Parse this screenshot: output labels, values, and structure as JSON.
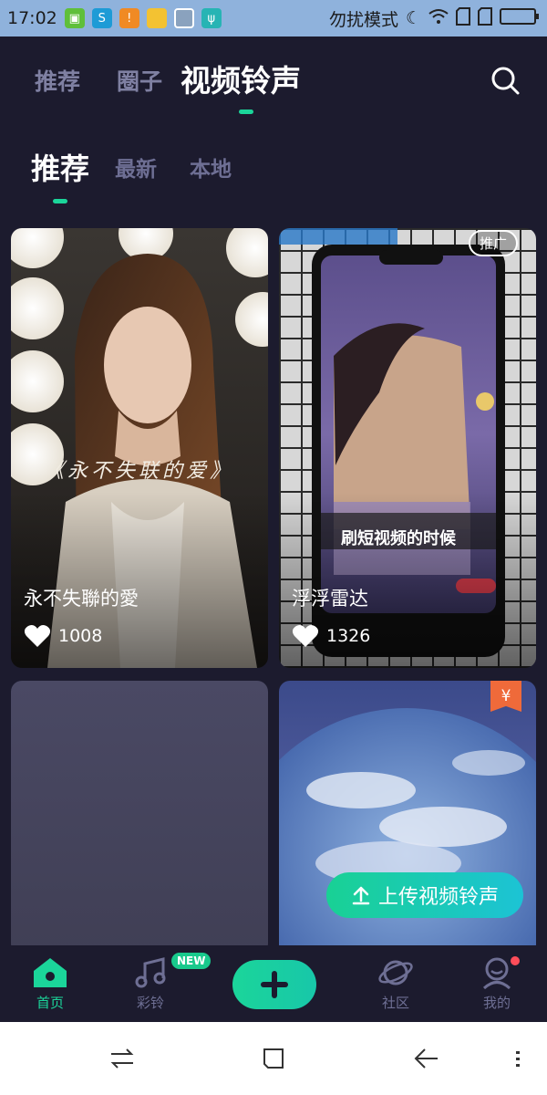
{
  "status_bar": {
    "time": "17:02",
    "dnd_text": "勿扰模式",
    "icons": [
      "app-icon",
      "sync-icon",
      "warning-icon",
      "folder-icon",
      "brush-icon",
      "usb-icon",
      "moon-icon",
      "wifi-icon",
      "sim1-icon",
      "sim2-icon",
      "battery-icon"
    ]
  },
  "top_tabs": {
    "items": [
      {
        "label": "推荐"
      },
      {
        "label": "圈子"
      },
      {
        "label": "视频铃声"
      }
    ],
    "active_index": 2
  },
  "sub_tabs": {
    "items": [
      {
        "label": "推荐"
      },
      {
        "label": "最新"
      },
      {
        "label": "本地"
      }
    ],
    "active_index": 0
  },
  "cards": [
    {
      "title": "永不失聯的愛",
      "likes": "1008",
      "overlay_text": "《永不失联的爱》"
    },
    {
      "title": "浮浮雷达",
      "likes": "1326",
      "promo_badge": "推广",
      "overlay_text": "刷短视频的时候"
    },
    {},
    {
      "yen_tag": "¥"
    }
  ],
  "upload_button": {
    "label": "上传视频铃声"
  },
  "bottom_nav": {
    "items": [
      {
        "label": "首页",
        "icon": "home-icon"
      },
      {
        "label": "彩铃",
        "icon": "music-icon"
      },
      {
        "label": "",
        "icon": "plus-icon"
      },
      {
        "label": "社区",
        "icon": "planet-icon"
      },
      {
        "label": "我的",
        "icon": "profile-icon"
      }
    ],
    "new_badge": "NEW",
    "accent": "#1bd59a"
  },
  "system_nav": {
    "icons": [
      "switch-icon",
      "home-square-icon",
      "back-icon",
      "menu-icon"
    ]
  }
}
